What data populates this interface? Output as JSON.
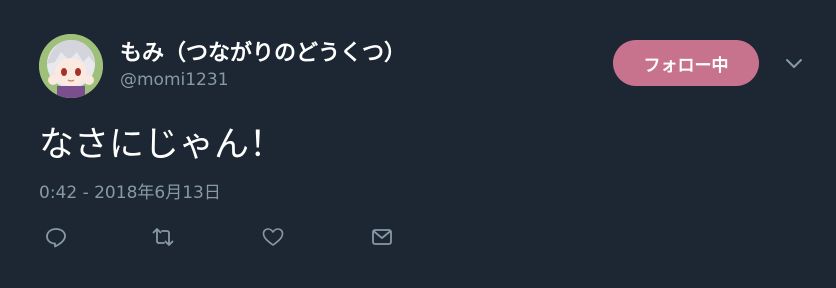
{
  "user": {
    "display_name": "もみ（つながりのどうくつ）",
    "handle": "@momi1231"
  },
  "follow_button": {
    "label": "フォロー中",
    "color": "#c8738e"
  },
  "tweet": {
    "text": "なさにじゃん！",
    "timestamp": "0:42 - 2018年6月13日"
  },
  "actions": [
    {
      "icon": "reply-icon"
    },
    {
      "icon": "retweet-icon"
    },
    {
      "icon": "like-icon"
    },
    {
      "icon": "message-icon"
    }
  ],
  "colors": {
    "background": "#1c2733",
    "secondary_text": "#8899a6",
    "primary_text": "#ffffff"
  }
}
